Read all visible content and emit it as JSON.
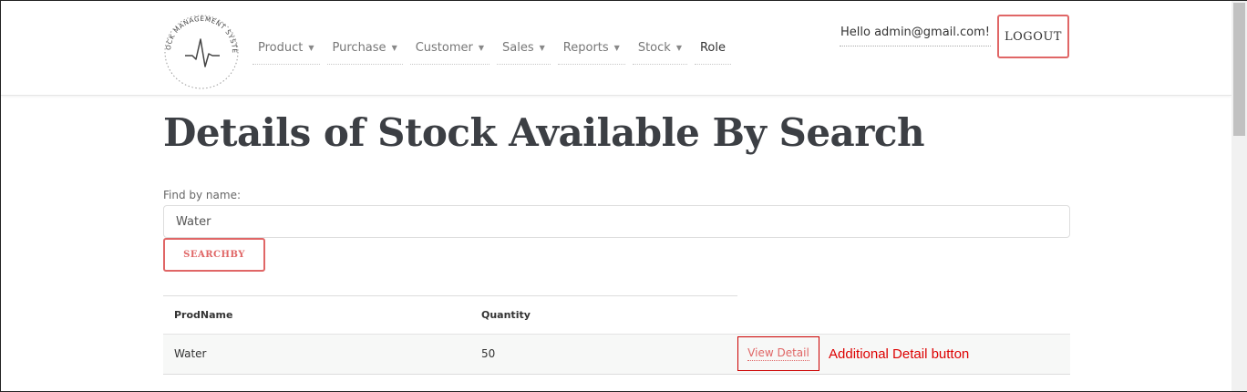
{
  "logo": {
    "text": "STOCK MANAGEMENT SYSTEM"
  },
  "nav": {
    "items": [
      {
        "label": "Product",
        "dropdown": true
      },
      {
        "label": "Purchase",
        "dropdown": true
      },
      {
        "label": "Customer",
        "dropdown": true
      },
      {
        "label": "Sales",
        "dropdown": true
      },
      {
        "label": "Reports",
        "dropdown": true
      },
      {
        "label": "Stock",
        "dropdown": true
      },
      {
        "label": "Role",
        "dropdown": false
      }
    ]
  },
  "user": {
    "greeting": "Hello admin@gmail.com!",
    "logout_label": "LOGOUT"
  },
  "main": {
    "title": "Details of Stock Available By Search",
    "search": {
      "label": "Find by name:",
      "value": "Water",
      "button_label": "SEARCHBY"
    },
    "table": {
      "headers": [
        "ProdName",
        "Quantity"
      ],
      "rows": [
        {
          "prodname": "Water",
          "quantity": "50",
          "action_label": "View Detail"
        }
      ]
    },
    "annotation": "Additional Detail button"
  },
  "colors": {
    "accent": "#e06666",
    "annotation": "#dd0000",
    "title": "#3c3f44"
  }
}
